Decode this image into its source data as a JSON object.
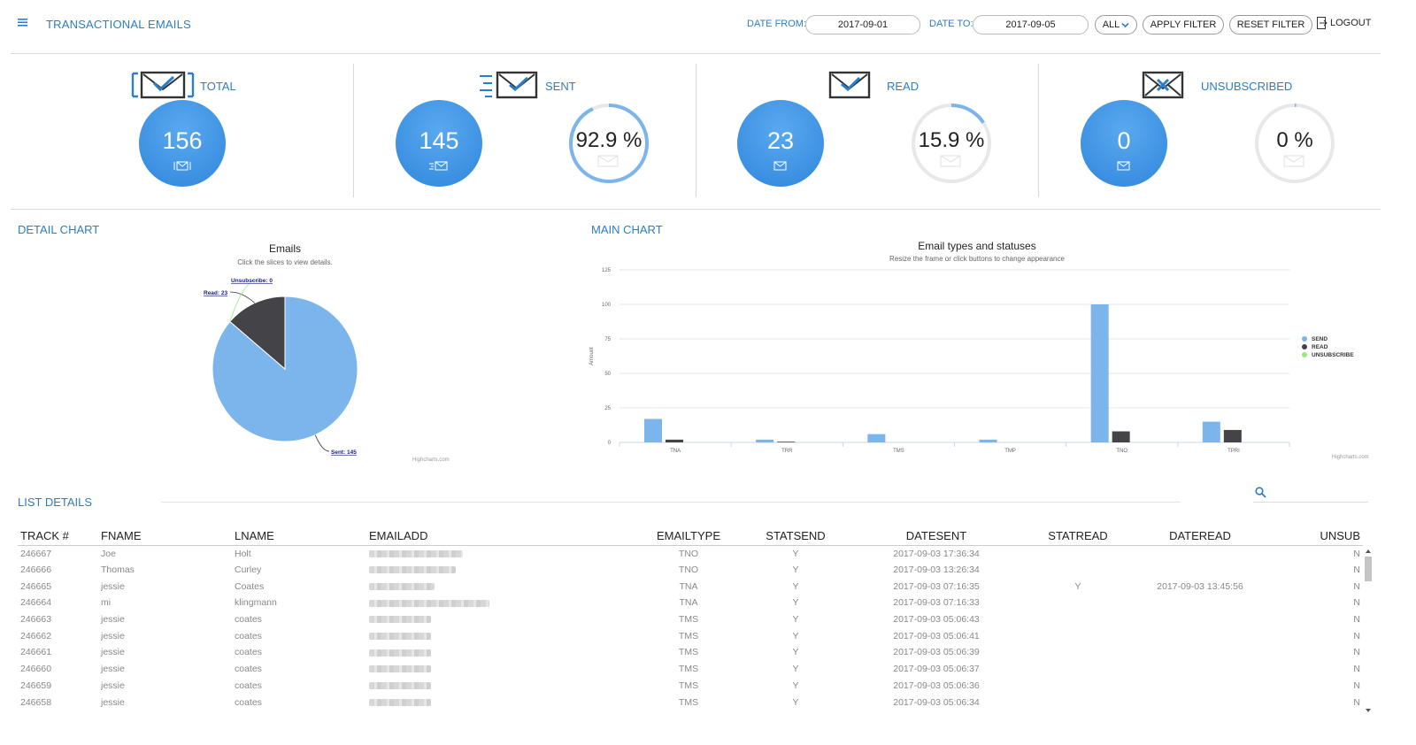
{
  "header": {
    "title": "TRANSACTIONAL EMAILS",
    "date_from_label": "DATE FROM:",
    "date_from_value": "2017-09-01",
    "date_to_label": "DATE TO:",
    "date_to_value": "2017-09-05",
    "type_select": "ALL",
    "apply_label": "APPLY FILTER",
    "reset_label": "RESET FILTER",
    "logout_label": "LOGOUT"
  },
  "stats": {
    "total": {
      "label": "TOTAL",
      "value": "156"
    },
    "sent": {
      "label": "SENT",
      "value": "145",
      "percent": "92.9 %",
      "fraction": 0.929
    },
    "read": {
      "label": "READ",
      "value": "23",
      "percent": "15.9 %",
      "fraction": 0.159
    },
    "unsubscribed": {
      "label": "UNSUBSCRIBED",
      "value": "0",
      "percent": "0 %",
      "fraction": 0.0
    }
  },
  "detail_chart": {
    "section_title": "DETAIL CHART",
    "credits": "Highcharts.com"
  },
  "main_chart": {
    "section_title": "MAIN CHART",
    "credits": "Highcharts.com"
  },
  "chart_data": [
    {
      "type": "pie",
      "title": "Emails",
      "subtitle": "Click the slices to view details.",
      "slices": [
        {
          "name": "Sent",
          "value": 145,
          "label": "Sent: 145",
          "color": "#7cb5ec"
        },
        {
          "name": "Read",
          "value": 23,
          "label": "Read: 23",
          "color": "#434348"
        },
        {
          "name": "Unsubscribe",
          "value": 0,
          "label": "Unsubscribe: 0",
          "color": "#90ed7d"
        }
      ]
    },
    {
      "type": "bar",
      "title": "Email types and statuses",
      "subtitle": "Resize the frame or click buttons to change appearance",
      "ylabel": "Amount",
      "ylim": [
        0,
        125
      ],
      "yticks": [
        "0",
        "25",
        "50",
        "75",
        "100",
        "125"
      ],
      "categories": [
        "TNA",
        "TRR",
        "TMS",
        "TMP",
        "TNO",
        "TPRI"
      ],
      "series": [
        {
          "name": "SEND",
          "color": "#7cb5ec",
          "values": [
            17,
            2,
            6,
            2,
            100,
            15
          ]
        },
        {
          "name": "READ",
          "color": "#434348",
          "values": [
            2,
            0.5,
            0,
            0,
            8,
            9
          ]
        },
        {
          "name": "UNSUBSCRIBE",
          "color": "#90ed7d",
          "values": [
            0,
            0,
            0,
            0,
            0,
            0
          ]
        }
      ],
      "legend": "right",
      "grid": true
    }
  ],
  "list": {
    "section_title": "LIST DETAILS",
    "columns": [
      "TRACK #",
      "FNAME",
      "LNAME",
      "EMAILADD",
      "EMAILTYPE",
      "STATSEND",
      "DATESENT",
      "STATREAD",
      "DATEREAD",
      "UNSUB"
    ],
    "rows": [
      {
        "track": "246667",
        "fname": "Joe",
        "lname": "Holt",
        "type": "TNO",
        "statsend": "Y",
        "datesent": "2017-09-03 17:36:34",
        "statread": "",
        "dateread": "",
        "unsub": "N"
      },
      {
        "track": "246666",
        "fname": "Thomas",
        "lname": "Curley",
        "type": "TNO",
        "statsend": "Y",
        "datesent": "2017-09-03 13:26:34",
        "statread": "",
        "dateread": "",
        "unsub": "N"
      },
      {
        "track": "246665",
        "fname": "jessie",
        "lname": "Coates",
        "type": "TNA",
        "statsend": "Y",
        "datesent": "2017-09-03 07:16:35",
        "statread": "Y",
        "dateread": "2017-09-03 13:45:56",
        "unsub": "N"
      },
      {
        "track": "246664",
        "fname": "mi",
        "lname": "klingmann",
        "type": "TNA",
        "statsend": "Y",
        "datesent": "2017-09-03 07:16:33",
        "statread": "",
        "dateread": "",
        "unsub": "N"
      },
      {
        "track": "246663",
        "fname": "jessie",
        "lname": "coates",
        "type": "TMS",
        "statsend": "Y",
        "datesent": "2017-09-03 05:06:43",
        "statread": "",
        "dateread": "",
        "unsub": "N"
      },
      {
        "track": "246662",
        "fname": "jessie",
        "lname": "coates",
        "type": "TMS",
        "statsend": "Y",
        "datesent": "2017-09-03 05:06:41",
        "statread": "",
        "dateread": "",
        "unsub": "N"
      },
      {
        "track": "246661",
        "fname": "jessie",
        "lname": "coates",
        "type": "TMS",
        "statsend": "Y",
        "datesent": "2017-09-03 05:06:39",
        "statread": "",
        "dateread": "",
        "unsub": "N"
      },
      {
        "track": "246660",
        "fname": "jessie",
        "lname": "coates",
        "type": "TMS",
        "statsend": "Y",
        "datesent": "2017-09-03 05:06:37",
        "statread": "",
        "dateread": "",
        "unsub": "N"
      },
      {
        "track": "246659",
        "fname": "jessie",
        "lname": "coates",
        "type": "TMS",
        "statsend": "Y",
        "datesent": "2017-09-03 05:06:36",
        "statread": "",
        "dateread": "",
        "unsub": "N"
      },
      {
        "track": "246658",
        "fname": "jessie",
        "lname": "coates",
        "type": "TMS",
        "statsend": "Y",
        "datesent": "2017-09-03 05:06:34",
        "statread": "",
        "dateread": "",
        "unsub": "N"
      }
    ]
  }
}
